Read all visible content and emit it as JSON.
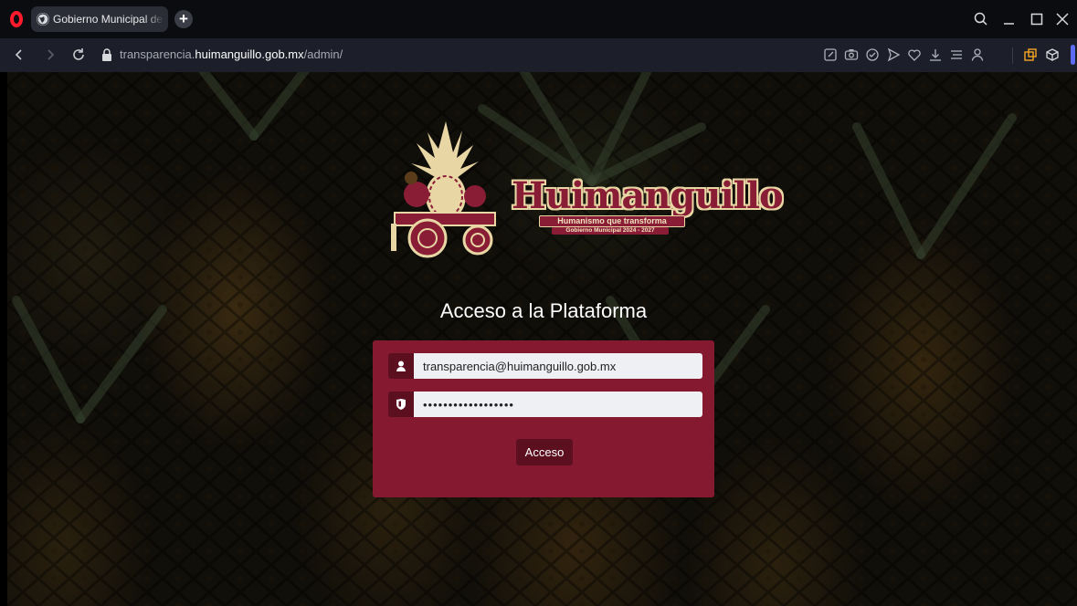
{
  "browser": {
    "tab_title": "Gobierno Municipal de Hu",
    "newtab_label": "+",
    "url_prefix": "transparencia.",
    "url_host": "huimanguillo.gob.mx",
    "url_path": "/admin/",
    "toolbar_icons": [
      "snapshot-edit-icon",
      "camera-icon",
      "shield-check-icon",
      "send-icon",
      "heart-icon",
      "download-icon",
      "list-icon",
      "user-icon",
      "extensions-icon",
      "cube-icon"
    ],
    "window_controls": [
      "search-icon",
      "minimize-icon",
      "maximize-icon",
      "close-icon"
    ],
    "opera_red": "#ff1b2d",
    "accent": "#5d6cf5"
  },
  "logo": {
    "name": "Huimanguillo",
    "tagline": "Humanismo que transforma",
    "government": "Gobierno Municipal 2024 - 2027"
  },
  "login": {
    "title": "Acceso a la Plataforma",
    "email_value": "transparencia@huimanguillo.gob.mx",
    "password_value": "••••••••••••••••••",
    "submit_label": "Acceso",
    "card_color": "#84192f",
    "dark_color": "#5c0f1f"
  }
}
